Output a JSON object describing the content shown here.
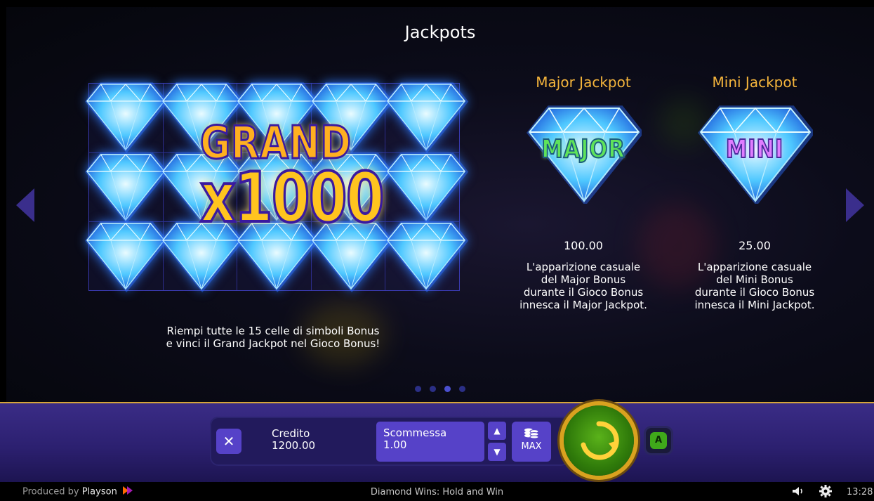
{
  "title": "Jackpots",
  "grand": {
    "word": "GRAND",
    "multiplier": "x1000",
    "description_line1": "Riempi tutte le 15 celle di simboli Bonus",
    "description_line2": "e vinci il Grand Jackpot nel Gioco Bonus!"
  },
  "major": {
    "title": "Major Jackpot",
    "gem_label": "MAJOR",
    "value": "100.00",
    "desc": [
      "L'apparizione casuale",
      "del Major Bonus",
      "durante il Gioco Bonus",
      "innesca il Major Jackpot."
    ]
  },
  "mini": {
    "title": "Mini Jackpot",
    "gem_label": "MINI",
    "value": "25.00",
    "desc": [
      "L'apparizione casuale",
      "del Mini Bonus",
      "durante il Gioco Bonus",
      "innesca il Mini Jackpot."
    ]
  },
  "pagination": {
    "total": 4,
    "active_index": 2
  },
  "controls": {
    "close_symbol": "✕",
    "credit_label": "Credito",
    "credit_value": "1200.00",
    "bet_label": "Scommessa",
    "bet_value": "1.00",
    "up_symbol": "▲",
    "down_symbol": "▼",
    "max_label": "MAX",
    "autoplay_symbol": "A"
  },
  "footer": {
    "produced_by": "Produced by",
    "brand": "Playson",
    "game_title": "Diamond Wins: Hold and Win",
    "time": "13:28"
  },
  "colors": {
    "accent_gold": "#f5b53c",
    "panel_purple": "#5642c8",
    "spin_green": "#3fa81a",
    "gem_blue": "#49c6ff"
  },
  "icons": {
    "left": "arrow-left-icon",
    "right": "arrow-right-icon",
    "sound": "speaker-icon",
    "settings": "gear-icon",
    "spin": "spin-arrow-icon",
    "coins": "coins-stack-icon"
  }
}
